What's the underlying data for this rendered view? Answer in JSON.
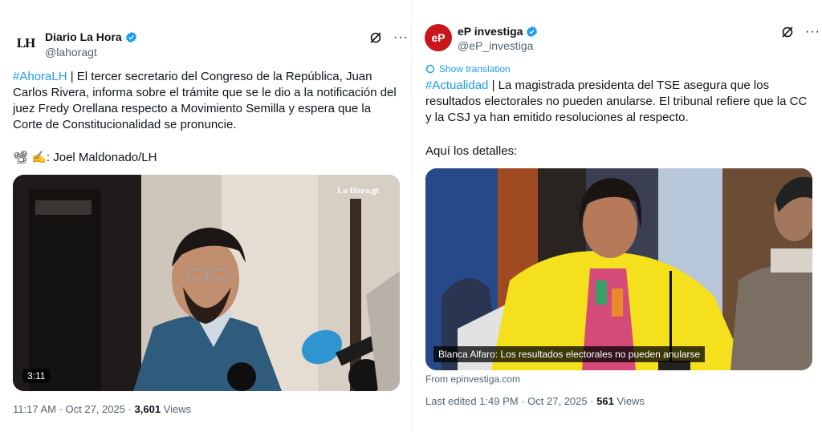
{
  "tweets": [
    {
      "avatar_text": "LH",
      "name": "Diario La Hora",
      "handle": "@lahoragt",
      "hashtag": "#AhoraLH",
      "text": " | El tercer secretario del Congreso de la República, Juan Carlos Rivera, informa sobre el trámite que se le dio a la notificación del juez Fredy Orellana respecto a Movimiento Semilla y espera que la Corte de Constitucionalidad se pronuncie.",
      "credit": "📽 ✍: Joel Maldonado/LH",
      "watermark": "La Hora.gt",
      "duration": "3:11",
      "time": "11:17 AM · Oct 27, 2025 · ",
      "views_count": "3,601",
      "views_label": " Views"
    },
    {
      "avatar_text": "eP",
      "name": "eP investiga",
      "handle": "@eP_investiga",
      "show_translation": "Show translation",
      "hashtag": "#Actualidad",
      "text": " | La magistrada presidenta del TSE asegura que los resultados electorales no pueden anularse. El tribunal refiere que la CC y la CSJ ya han emitido resoluciones al respecto.",
      "text2": "Aquí los detalles:",
      "caption": "Blanca Alfaro: Los resultados electorales no pueden anularse",
      "from": "From epinvestiga.com",
      "time": "Last edited 1:49 PM · Oct 27, 2025 · ",
      "views_count": "561",
      "views_label": " Views"
    }
  ],
  "colors": {
    "link": "#1d9bf0",
    "muted": "#536471",
    "ep_brand": "#c8161d",
    "highlight_yellow": "#f4e01c"
  }
}
